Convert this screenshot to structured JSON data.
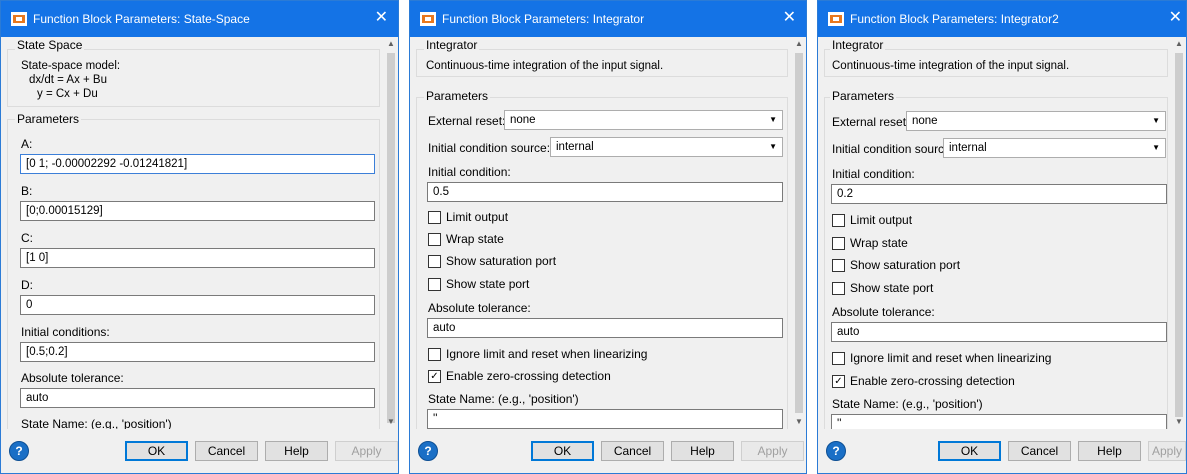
{
  "colors": {
    "titlebar": "#1473e6",
    "focus_border": "#3c7fd8"
  },
  "icons": {
    "app": "matlab-block-icon",
    "close": "close-icon",
    "help": "help-icon"
  },
  "buttons": {
    "ok": "OK",
    "cancel": "Cancel",
    "help": "Help",
    "apply": "Apply"
  },
  "win1": {
    "title": "Function Block Parameters: State-Space",
    "section": "State Space",
    "desc": [
      "State-space model:",
      "dx/dt = Ax + Bu",
      "y = Cx + Du"
    ],
    "params_title": "Parameters",
    "fields": [
      {
        "label": "A:",
        "value": "[0 1; -0.00002292 -0.01241821]"
      },
      {
        "label": "B:",
        "value": "[0;0.00015129]"
      },
      {
        "label": "C:",
        "value": "[1 0]"
      },
      {
        "label": "D:",
        "value": "0"
      },
      {
        "label": "Initial conditions:",
        "value": "[0.5;0.2]"
      },
      {
        "label": "Absolute tolerance:",
        "value": "auto"
      },
      {
        "label": "State Name: (e.g., 'position')",
        "value": "''"
      }
    ]
  },
  "win2": {
    "title": "Function Block Parameters: Integrator",
    "section": "Integrator",
    "desc": "Continuous-time integration of the input signal.",
    "params_title": "Parameters",
    "reset_label": "External reset:",
    "reset_value": "none",
    "ic_source_label": "Initial condition source:",
    "ic_source_value": "internal",
    "ic_label": "Initial condition:",
    "ic_value": "0.5",
    "checks": [
      {
        "label": "Limit output",
        "checked": false
      },
      {
        "label": "Wrap state",
        "checked": false
      },
      {
        "label": "Show saturation port",
        "checked": false
      },
      {
        "label": "Show state port",
        "checked": false
      }
    ],
    "abstol_label": "Absolute tolerance:",
    "abstol_value": "auto",
    "checks2": [
      {
        "label": "Ignore limit and reset when linearizing",
        "checked": false
      },
      {
        "label": "Enable zero-crossing detection",
        "checked": true
      }
    ],
    "state_label": "State Name: (e.g., 'position')",
    "state_value": "''"
  },
  "win3": {
    "title": "Function Block Parameters: Integrator2",
    "section": "Integrator",
    "desc": "Continuous-time integration of the input signal.",
    "params_title": "Parameters",
    "reset_label": "External reset:",
    "reset_value": "none",
    "ic_source_label": "Initial condition source:",
    "ic_source_value": "internal",
    "ic_label": "Initial condition:",
    "ic_value": "0.2",
    "checks": [
      {
        "label": "Limit output",
        "checked": false
      },
      {
        "label": "Wrap state",
        "checked": false
      },
      {
        "label": "Show saturation port",
        "checked": false
      },
      {
        "label": "Show state port",
        "checked": false
      }
    ],
    "abstol_label": "Absolute tolerance:",
    "abstol_value": "auto",
    "checks2": [
      {
        "label": "Ignore limit and reset when linearizing",
        "checked": false
      },
      {
        "label": "Enable zero-crossing detection",
        "checked": true
      }
    ],
    "state_label": "State Name: (e.g., 'position')",
    "state_value": "''"
  }
}
